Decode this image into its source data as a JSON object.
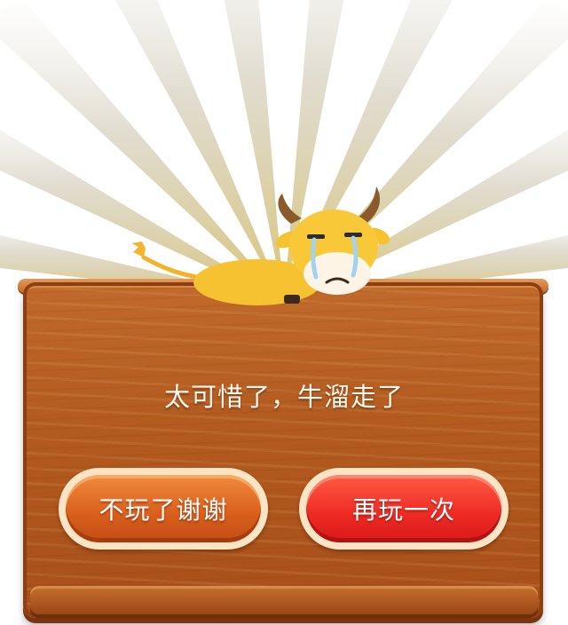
{
  "dialog": {
    "message": "太可惜了，牛溜走了",
    "buttons": {
      "quit_label": "不玩了谢谢",
      "retry_label": "再玩一次"
    }
  },
  "illustration": {
    "character": "crying-cow",
    "background": "sunburst-rays"
  },
  "colors": {
    "wood": "#b25a1f",
    "quit_button": "#d85e1c",
    "retry_button": "#ee2a24",
    "button_rim": "#fde4c4",
    "cow_body": "#f7c232"
  }
}
